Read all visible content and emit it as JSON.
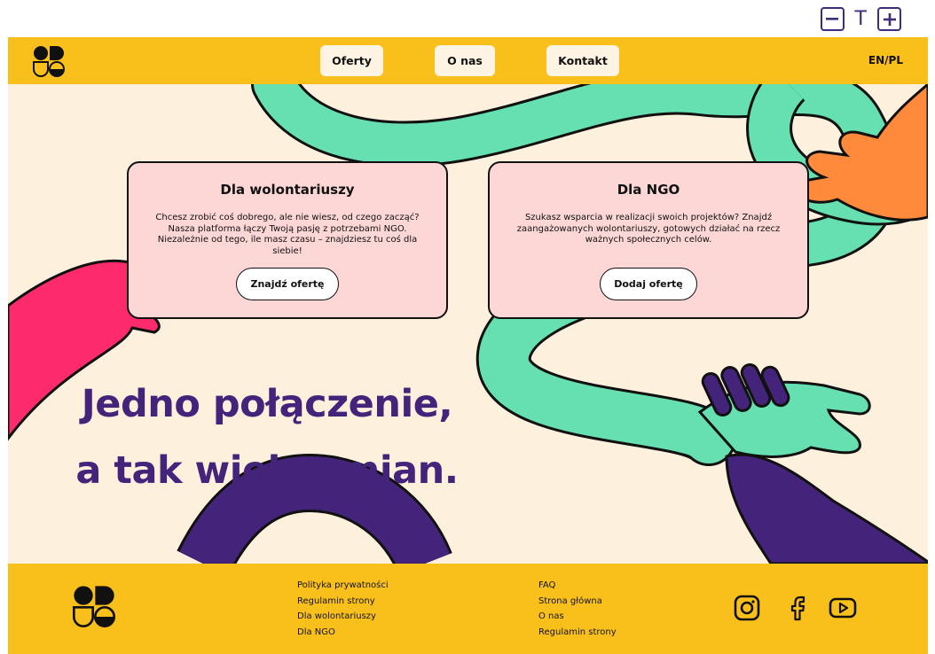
{
  "accessibility": {
    "decrease_icon": "minus-square-icon",
    "text_label": "T",
    "increase_icon": "plus-square-icon"
  },
  "header": {
    "logo_icon": "brand-logo",
    "nav": [
      {
        "label": "Oferty"
      },
      {
        "label": "O nas"
      },
      {
        "label": "Kontakt"
      }
    ],
    "language": "EN/PL"
  },
  "cards": [
    {
      "title": "Dla wolontariuszy",
      "body": "Chcesz zrobić coś dobrego, ale nie wiesz, od czego zacząć? Nasza platforma łączy Twoją pasję z potrzebami NGO. Niezależnie od tego, ile masz czasu – znajdziesz tu coś dla siebie!",
      "button": "Znajdź ofertę"
    },
    {
      "title": "Dla NGO",
      "body": "Szukasz wsparcia w realizacji swoich projektów? Znajdź zaangażowanych wolontariuszy, gotowych działać na rzecz ważnych społecznych celów.",
      "button": "Dodaj ofertę"
    }
  ],
  "hero": {
    "headline_line1": "Jedno połączenie,",
    "headline_line2": "a tak wiele zmian."
  },
  "footer": {
    "col1": [
      "Polityka prywatności",
      "Regulamin strony",
      "Dla wolontariuszy",
      "Dla NGO"
    ],
    "col2": [
      "FAQ",
      "Strona główna",
      "O nas",
      "Regulamin strony"
    ],
    "social": [
      "instagram-icon",
      "facebook-icon",
      "youtube-icon"
    ]
  },
  "colors": {
    "yellow": "#f9c01c",
    "cream": "#fdf1dd",
    "purple": "#44247a",
    "mint": "#66e0b0",
    "pink": "#fd2b6e",
    "orange": "#ff8a3c",
    "card": "#fdd6d6"
  }
}
